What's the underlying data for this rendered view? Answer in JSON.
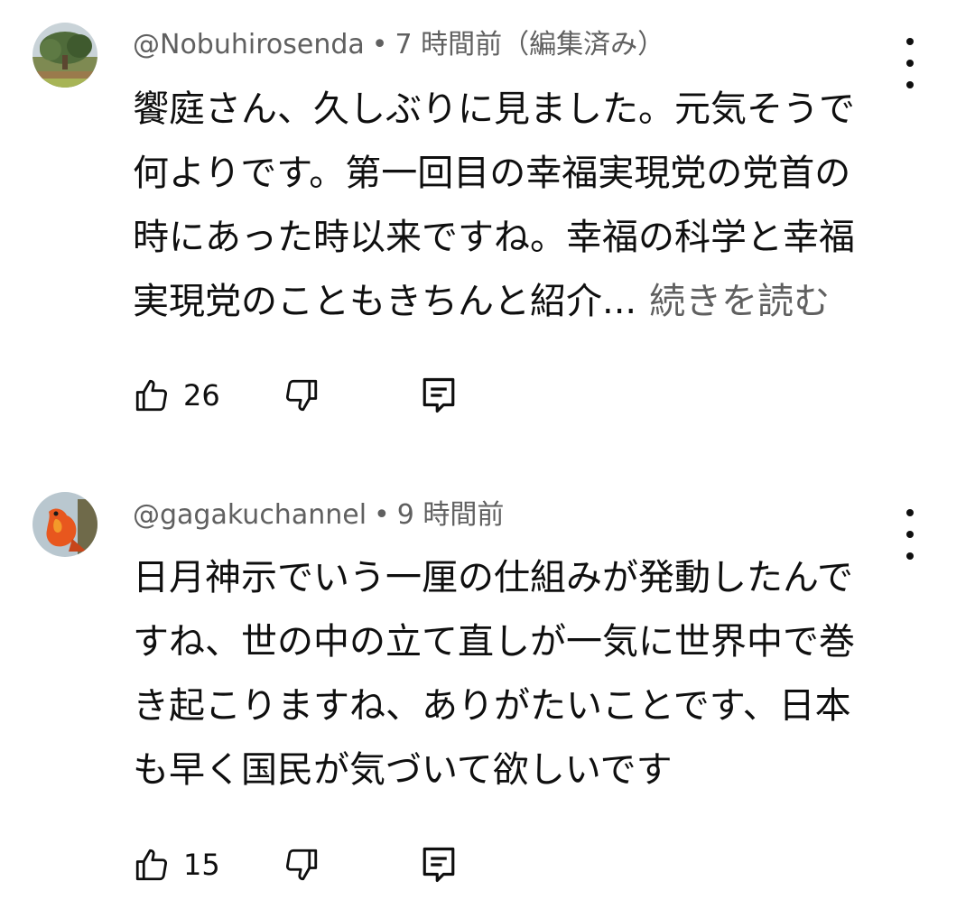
{
  "comments": [
    {
      "author": "@Nobuhirosenda",
      "time": "7 時間前（編集済み）",
      "lines": [
        "饗庭さん、久しぶりに見ました。元気そうで",
        "何よりです。第一回目の幸福実現党の党首の",
        "時にあった時以来ですね。幸福の科学と幸福",
        "実現党のこともきちんと紹介..."
      ],
      "read_more": "続きを読む",
      "likes": "26",
      "avatar_icon": "avatar-tree-photo"
    },
    {
      "author": "@gagakuchannel",
      "time": "9 時間前",
      "lines": [
        "日月神示でいう一厘の仕組みが発動したんで",
        "すね、世の中の立て直しが一気に世界中で巻",
        "き起こりますね、ありがたいことです、日本",
        "も早く国民が気づいて欲しいです"
      ],
      "likes": "15",
      "avatar_icon": "avatar-phoenix-photo"
    }
  ],
  "separator": "•",
  "icons": {
    "like": "thumbs-up-icon",
    "dislike": "thumbs-down-icon",
    "reply": "reply-icon",
    "menu": "more-vert-icon"
  }
}
